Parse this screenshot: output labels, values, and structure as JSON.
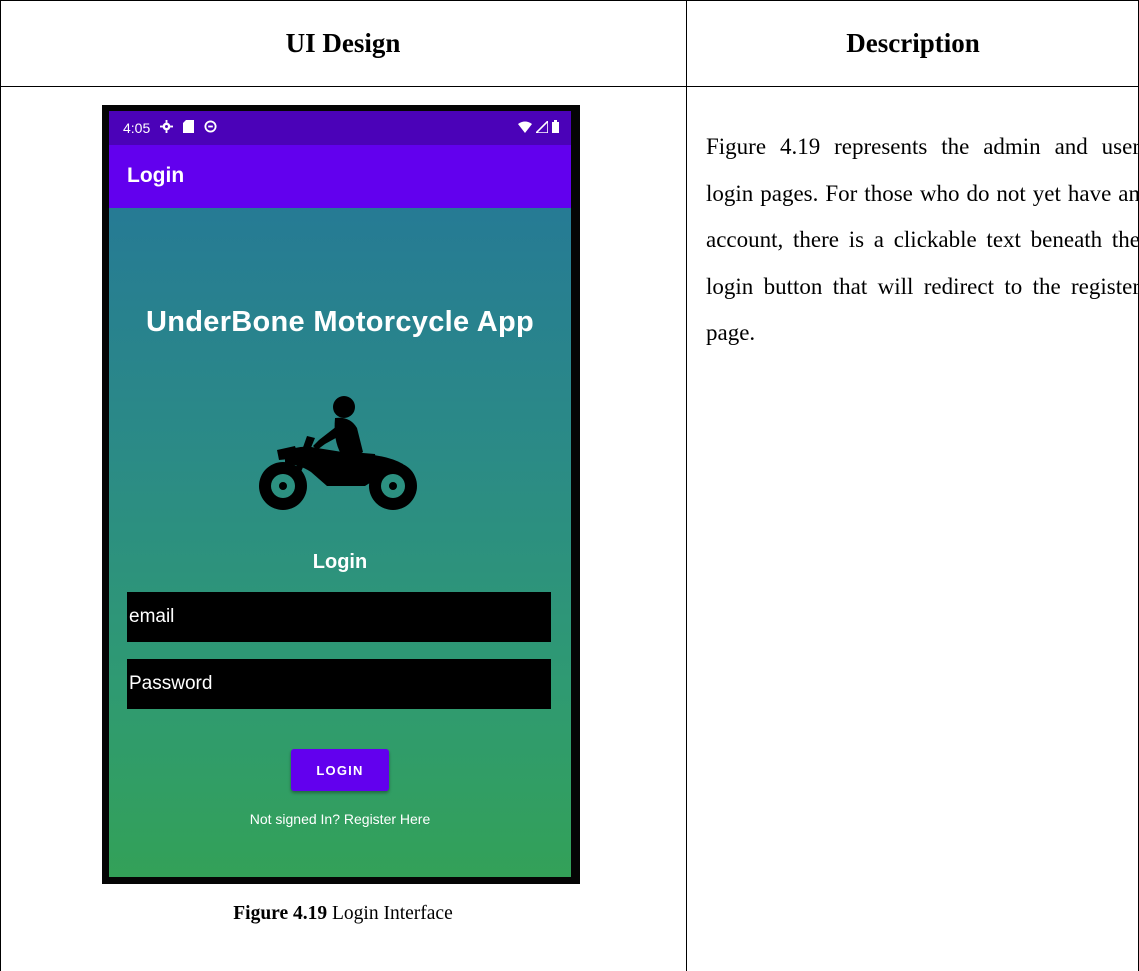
{
  "table": {
    "col1_header": "UI Design",
    "col2_header": "Description"
  },
  "description": "Figure 4.19 represents the admin and user login pages. For those who do not yet have an account, there is a clickable text beneath the login button that will redirect to the register page.",
  "caption": {
    "label": "Figure 4.19",
    "text": " Login Interface"
  },
  "phone": {
    "status_time": "4:05",
    "app_bar_title": "Login",
    "app_name": "UnderBone Motorcycle App",
    "login_heading": "Login",
    "email_hint": "email",
    "password_hint": "Password",
    "login_button": "LOGIN",
    "register_link": "Not signed In? Register Here",
    "colors": {
      "status_bar": "#4b02b8",
      "app_bar": "#6200ee",
      "gradient_top": "#24749a",
      "gradient_bottom": "#33a158",
      "button": "#6200ee"
    },
    "icons": [
      "gear-icon",
      "sd-card-icon",
      "data-saver-icon",
      "wifi-icon",
      "signal-icon",
      "battery-icon",
      "motorcycle-rider-icon"
    ]
  }
}
